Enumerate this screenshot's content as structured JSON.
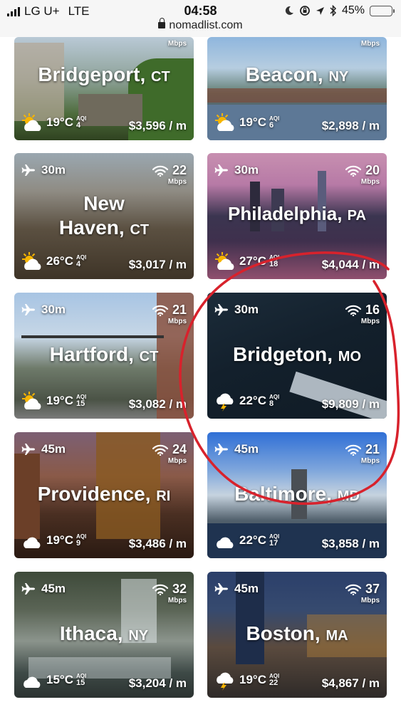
{
  "status_bar": {
    "carrier": "LG U+",
    "network": "LTE",
    "time": "04:58",
    "battery": "45%",
    "battery_level": 0.45,
    "url": "nomadlist.com"
  },
  "cards": [
    {
      "city": "Bridgeport",
      "state": "CT",
      "flight": "",
      "speed": "",
      "speed_unit": "Mbps",
      "temp": "19°C",
      "aqi_label": "AQI",
      "aqi": "4",
      "cost": "$3,596 / m",
      "weather_icon": "sun-cloud-icon"
    },
    {
      "city": "Beacon",
      "state": "NY",
      "flight": "",
      "speed": "",
      "speed_unit": "Mbps",
      "temp": "19°C",
      "aqi_label": "AQI",
      "aqi": "6",
      "cost": "$2,898 / m",
      "weather_icon": "sun-cloud-icon"
    },
    {
      "city": "New",
      "city2": "Haven",
      "state": "CT",
      "flight": "30m",
      "speed": "22",
      "speed_unit": "Mbps",
      "temp": "26°C",
      "aqi_label": "AQI",
      "aqi": "4",
      "cost": "$3,017 / m",
      "weather_icon": "sun-cloud-icon"
    },
    {
      "city": "Philadelphia",
      "state": "PA",
      "flight": "30m",
      "speed": "20",
      "speed_unit": "Mbps",
      "temp": "27°C",
      "aqi_label": "AQI",
      "aqi": "18",
      "cost": "$4,044 / m",
      "weather_icon": "sun-cloud-icon"
    },
    {
      "city": "Hartford",
      "state": "CT",
      "flight": "30m",
      "speed": "21",
      "speed_unit": "Mbps",
      "temp": "19°C",
      "aqi_label": "AQI",
      "aqi": "15",
      "cost": "$3,082 / m",
      "weather_icon": "sun-cloud-icon"
    },
    {
      "city": "Bridgeton",
      "state": "MO",
      "flight": "30m",
      "speed": "16",
      "speed_unit": "Mbps",
      "temp": "22°C",
      "aqi_label": "AQI",
      "aqi": "8",
      "cost": "$9,809 / m",
      "weather_icon": "storm-cloud-icon"
    },
    {
      "city": "Providence",
      "state": "RI",
      "flight": "45m",
      "speed": "24",
      "speed_unit": "Mbps",
      "temp": "19°C",
      "aqi_label": "AQI",
      "aqi": "9",
      "cost": "$3,486 / m",
      "weather_icon": "cloud-icon"
    },
    {
      "city": "Baltimore",
      "state": "MD",
      "flight": "45m",
      "speed": "21",
      "speed_unit": "Mbps",
      "temp": "22°C",
      "aqi_label": "AQI",
      "aqi": "17",
      "cost": "$3,858 / m",
      "weather_icon": "cloud-icon"
    },
    {
      "city": "Ithaca",
      "state": "NY",
      "flight": "45m",
      "speed": "32",
      "speed_unit": "Mbps",
      "temp": "15°C",
      "aqi_label": "AQI",
      "aqi": "15",
      "cost": "$3,204 / m",
      "weather_icon": "cloud-icon"
    },
    {
      "city": "Boston",
      "state": "MA",
      "flight": "45m",
      "speed": "37",
      "speed_unit": "Mbps",
      "temp": "19°C",
      "aqi_label": "AQI",
      "aqi": "22",
      "cost": "$4,867 / m",
      "weather_icon": "storm-cloud-icon"
    }
  ],
  "colors": {
    "annotation_circle": "#d8222c",
    "battery": "#f2c318"
  }
}
